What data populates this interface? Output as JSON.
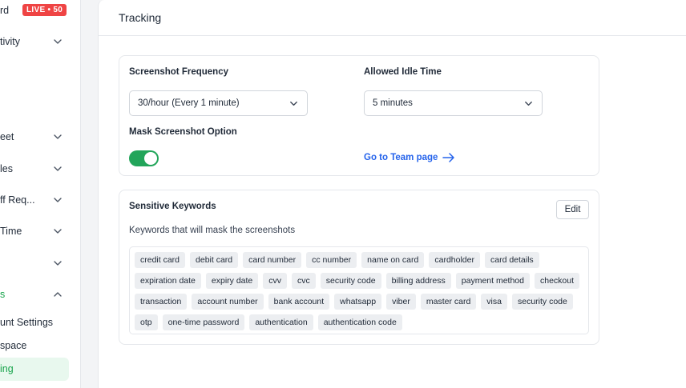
{
  "sidebar": {
    "live_badge": "LIVE • 50",
    "items": [
      {
        "label": "rd"
      },
      {
        "label": "tivity"
      },
      {
        "label": "eet"
      },
      {
        "label": "les"
      },
      {
        "label": "ff Req..."
      },
      {
        "label": "Time"
      },
      {
        "label": ""
      },
      {
        "label": "s"
      },
      {
        "label": "unt Settings"
      },
      {
        "label": "space"
      },
      {
        "label": "ing"
      }
    ]
  },
  "main": {
    "title": "Tracking",
    "screenshot_frequency": {
      "label": "Screenshot Frequency",
      "value": "30/hour (Every 1 minute)"
    },
    "idle_time": {
      "label": "Allowed Idle Time",
      "value": "5 minutes"
    },
    "mask": {
      "label": "Mask Screenshot Option",
      "enabled": true
    },
    "team_link": "Go to Team page",
    "keywords": {
      "title": "Sensitive Keywords",
      "edit_label": "Edit",
      "description": "Keywords that will mask the screenshots",
      "items": [
        "credit card",
        "debit card",
        "card number",
        "cc number",
        "name on card",
        "cardholder",
        "card details",
        "expiration date",
        "expiry date",
        "cvv",
        "cvc",
        "security code",
        "billing address",
        "payment method",
        "checkout",
        "transaction",
        "account number",
        "bank account",
        "whatsapp",
        "viber",
        "master card",
        "visa",
        "security code",
        "otp",
        "one-time password",
        "authentication",
        "authentication code"
      ]
    }
  },
  "colors": {
    "accent_green": "#22a55a",
    "link_blue": "#2563eb",
    "live_red": "#ef4444"
  }
}
